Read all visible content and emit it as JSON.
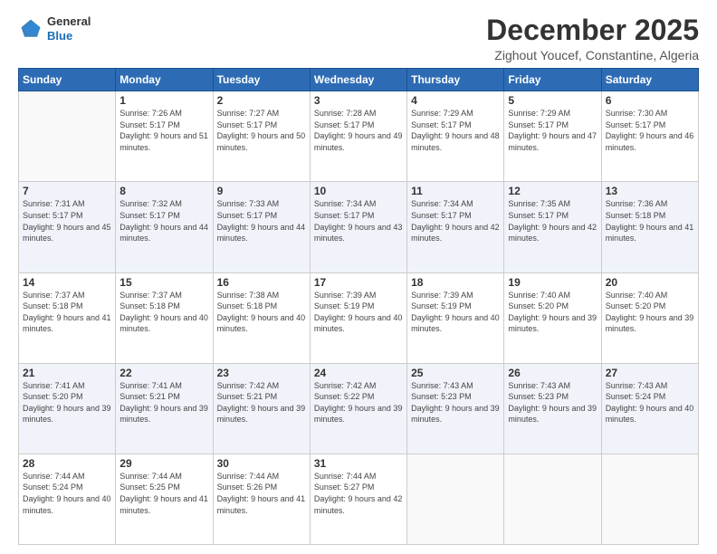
{
  "logo": {
    "line1": "General",
    "line2": "Blue"
  },
  "title": "December 2025",
  "subtitle": "Zighout Youcef, Constantine, Algeria",
  "days_of_week": [
    "Sunday",
    "Monday",
    "Tuesday",
    "Wednesday",
    "Thursday",
    "Friday",
    "Saturday"
  ],
  "weeks": [
    [
      {
        "day": "",
        "sunrise": "",
        "sunset": "",
        "daylight": ""
      },
      {
        "day": "1",
        "sunrise": "Sunrise: 7:26 AM",
        "sunset": "Sunset: 5:17 PM",
        "daylight": "Daylight: 9 hours and 51 minutes."
      },
      {
        "day": "2",
        "sunrise": "Sunrise: 7:27 AM",
        "sunset": "Sunset: 5:17 PM",
        "daylight": "Daylight: 9 hours and 50 minutes."
      },
      {
        "day": "3",
        "sunrise": "Sunrise: 7:28 AM",
        "sunset": "Sunset: 5:17 PM",
        "daylight": "Daylight: 9 hours and 49 minutes."
      },
      {
        "day": "4",
        "sunrise": "Sunrise: 7:29 AM",
        "sunset": "Sunset: 5:17 PM",
        "daylight": "Daylight: 9 hours and 48 minutes."
      },
      {
        "day": "5",
        "sunrise": "Sunrise: 7:29 AM",
        "sunset": "Sunset: 5:17 PM",
        "daylight": "Daylight: 9 hours and 47 minutes."
      },
      {
        "day": "6",
        "sunrise": "Sunrise: 7:30 AM",
        "sunset": "Sunset: 5:17 PM",
        "daylight": "Daylight: 9 hours and 46 minutes."
      }
    ],
    [
      {
        "day": "7",
        "sunrise": "Sunrise: 7:31 AM",
        "sunset": "Sunset: 5:17 PM",
        "daylight": "Daylight: 9 hours and 45 minutes."
      },
      {
        "day": "8",
        "sunrise": "Sunrise: 7:32 AM",
        "sunset": "Sunset: 5:17 PM",
        "daylight": "Daylight: 9 hours and 44 minutes."
      },
      {
        "day": "9",
        "sunrise": "Sunrise: 7:33 AM",
        "sunset": "Sunset: 5:17 PM",
        "daylight": "Daylight: 9 hours and 44 minutes."
      },
      {
        "day": "10",
        "sunrise": "Sunrise: 7:34 AM",
        "sunset": "Sunset: 5:17 PM",
        "daylight": "Daylight: 9 hours and 43 minutes."
      },
      {
        "day": "11",
        "sunrise": "Sunrise: 7:34 AM",
        "sunset": "Sunset: 5:17 PM",
        "daylight": "Daylight: 9 hours and 42 minutes."
      },
      {
        "day": "12",
        "sunrise": "Sunrise: 7:35 AM",
        "sunset": "Sunset: 5:17 PM",
        "daylight": "Daylight: 9 hours and 42 minutes."
      },
      {
        "day": "13",
        "sunrise": "Sunrise: 7:36 AM",
        "sunset": "Sunset: 5:18 PM",
        "daylight": "Daylight: 9 hours and 41 minutes."
      }
    ],
    [
      {
        "day": "14",
        "sunrise": "Sunrise: 7:37 AM",
        "sunset": "Sunset: 5:18 PM",
        "daylight": "Daylight: 9 hours and 41 minutes."
      },
      {
        "day": "15",
        "sunrise": "Sunrise: 7:37 AM",
        "sunset": "Sunset: 5:18 PM",
        "daylight": "Daylight: 9 hours and 40 minutes."
      },
      {
        "day": "16",
        "sunrise": "Sunrise: 7:38 AM",
        "sunset": "Sunset: 5:18 PM",
        "daylight": "Daylight: 9 hours and 40 minutes."
      },
      {
        "day": "17",
        "sunrise": "Sunrise: 7:39 AM",
        "sunset": "Sunset: 5:19 PM",
        "daylight": "Daylight: 9 hours and 40 minutes."
      },
      {
        "day": "18",
        "sunrise": "Sunrise: 7:39 AM",
        "sunset": "Sunset: 5:19 PM",
        "daylight": "Daylight: 9 hours and 40 minutes."
      },
      {
        "day": "19",
        "sunrise": "Sunrise: 7:40 AM",
        "sunset": "Sunset: 5:20 PM",
        "daylight": "Daylight: 9 hours and 39 minutes."
      },
      {
        "day": "20",
        "sunrise": "Sunrise: 7:40 AM",
        "sunset": "Sunset: 5:20 PM",
        "daylight": "Daylight: 9 hours and 39 minutes."
      }
    ],
    [
      {
        "day": "21",
        "sunrise": "Sunrise: 7:41 AM",
        "sunset": "Sunset: 5:20 PM",
        "daylight": "Daylight: 9 hours and 39 minutes."
      },
      {
        "day": "22",
        "sunrise": "Sunrise: 7:41 AM",
        "sunset": "Sunset: 5:21 PM",
        "daylight": "Daylight: 9 hours and 39 minutes."
      },
      {
        "day": "23",
        "sunrise": "Sunrise: 7:42 AM",
        "sunset": "Sunset: 5:21 PM",
        "daylight": "Daylight: 9 hours and 39 minutes."
      },
      {
        "day": "24",
        "sunrise": "Sunrise: 7:42 AM",
        "sunset": "Sunset: 5:22 PM",
        "daylight": "Daylight: 9 hours and 39 minutes."
      },
      {
        "day": "25",
        "sunrise": "Sunrise: 7:43 AM",
        "sunset": "Sunset: 5:23 PM",
        "daylight": "Daylight: 9 hours and 39 minutes."
      },
      {
        "day": "26",
        "sunrise": "Sunrise: 7:43 AM",
        "sunset": "Sunset: 5:23 PM",
        "daylight": "Daylight: 9 hours and 39 minutes."
      },
      {
        "day": "27",
        "sunrise": "Sunrise: 7:43 AM",
        "sunset": "Sunset: 5:24 PM",
        "daylight": "Daylight: 9 hours and 40 minutes."
      }
    ],
    [
      {
        "day": "28",
        "sunrise": "Sunrise: 7:44 AM",
        "sunset": "Sunset: 5:24 PM",
        "daylight": "Daylight: 9 hours and 40 minutes."
      },
      {
        "day": "29",
        "sunrise": "Sunrise: 7:44 AM",
        "sunset": "Sunset: 5:25 PM",
        "daylight": "Daylight: 9 hours and 41 minutes."
      },
      {
        "day": "30",
        "sunrise": "Sunrise: 7:44 AM",
        "sunset": "Sunset: 5:26 PM",
        "daylight": "Daylight: 9 hours and 41 minutes."
      },
      {
        "day": "31",
        "sunrise": "Sunrise: 7:44 AM",
        "sunset": "Sunset: 5:27 PM",
        "daylight": "Daylight: 9 hours and 42 minutes."
      },
      {
        "day": "",
        "sunrise": "",
        "sunset": "",
        "daylight": ""
      },
      {
        "day": "",
        "sunrise": "",
        "sunset": "",
        "daylight": ""
      },
      {
        "day": "",
        "sunrise": "",
        "sunset": "",
        "daylight": ""
      }
    ]
  ]
}
